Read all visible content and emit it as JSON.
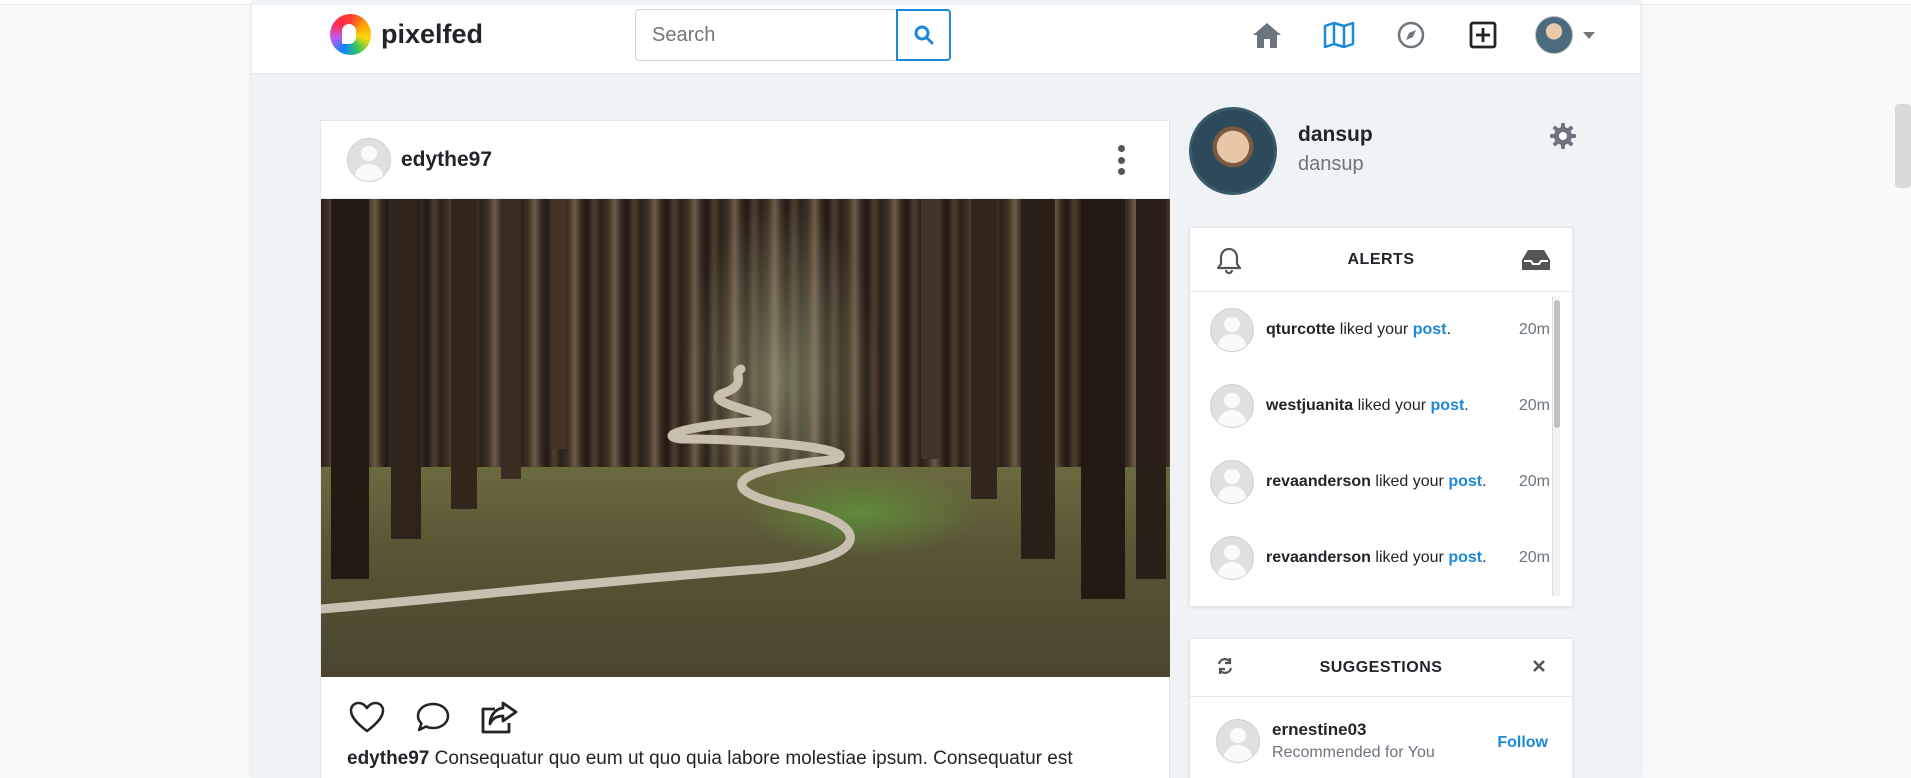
{
  "app": {
    "brand": "pixelfed"
  },
  "search": {
    "placeholder": "Search",
    "button_icon": "search-icon"
  },
  "nav": {
    "icons": [
      "home-icon",
      "map-icon",
      "compass-icon",
      "plus-square-icon"
    ],
    "avatar": "user-avatar",
    "menu_caret": "caret-down-icon"
  },
  "post": {
    "username": "edythe97",
    "menu_icon": "more-vertical-icon",
    "image_alt": "forest path",
    "actions": [
      "heart-icon",
      "comment-icon",
      "share-icon"
    ],
    "caption_user": "edythe97",
    "caption_text": " Consequatur quo eum ut quo quia labore molestiae ipsum. Consequatur est"
  },
  "profile": {
    "name": "dansup",
    "handle": "dansup",
    "settings_icon": "gear-icon"
  },
  "alerts": {
    "title": "ALERTS",
    "left_icon": "bell-icon",
    "right_icon": "inbox-icon",
    "items": [
      {
        "user": "qturcotte",
        "action": " liked your ",
        "link": "post",
        "end": ".",
        "time": "20m"
      },
      {
        "user": "westjuanita",
        "action": " liked your ",
        "link": "post",
        "end": ".",
        "time": "20m"
      },
      {
        "user": "revaanderson",
        "action": " liked your ",
        "link": "post",
        "end": ".",
        "time": "20m"
      },
      {
        "user": "revaanderson",
        "action": " liked your ",
        "link": "post",
        "end": ".",
        "time": "20m"
      }
    ]
  },
  "suggestions": {
    "title": "SUGGESTIONS",
    "left_icon": "refresh-icon",
    "right_icon": "close-icon",
    "items": [
      {
        "user": "ernestine03",
        "sub": "Recommended for You",
        "action": "Follow"
      }
    ]
  }
}
